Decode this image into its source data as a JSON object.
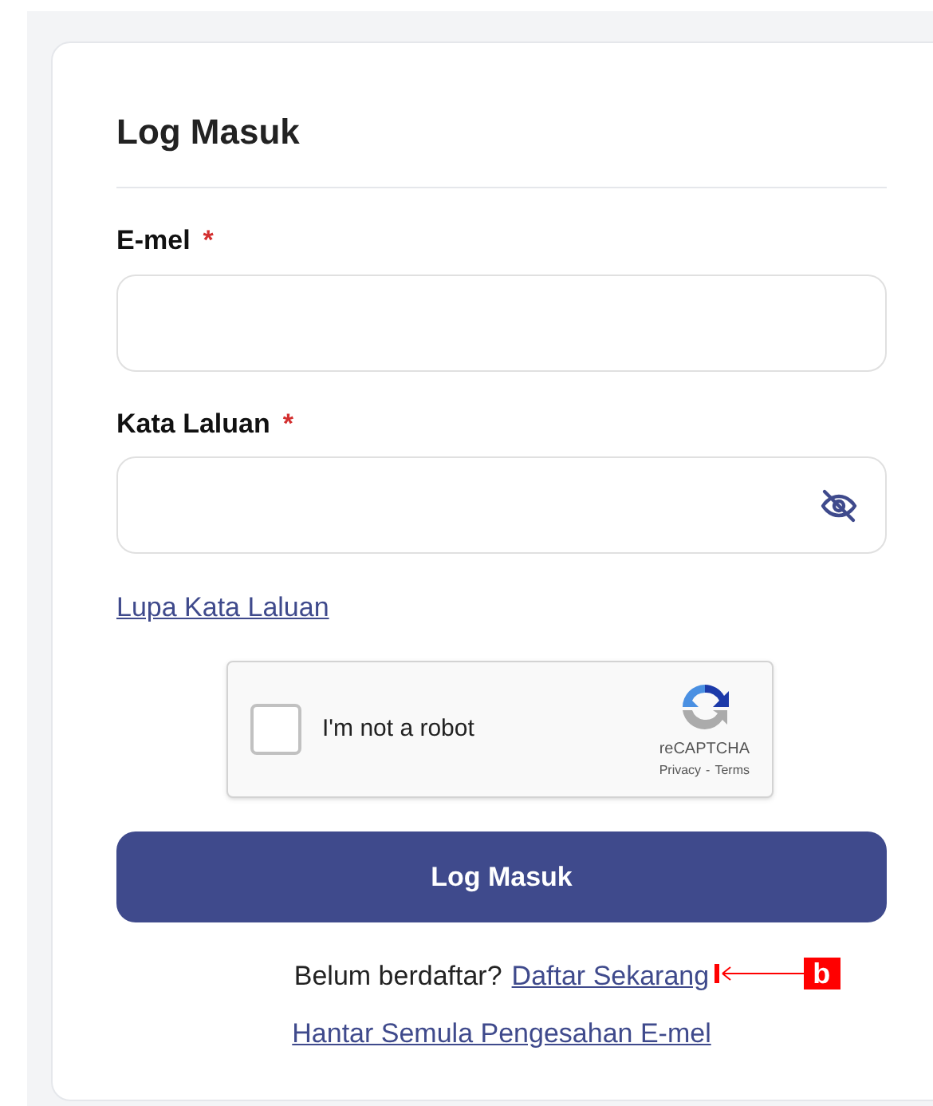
{
  "title": "Log Masuk",
  "fields": [
    {
      "label": "E-mel",
      "required_mark": "*",
      "kind": "text"
    },
    {
      "label": "Kata Laluan",
      "required_mark": "*",
      "kind": "password"
    }
  ],
  "forgot_link": "Lupa Kata Laluan",
  "captcha": {
    "label": "I'm not a robot",
    "checked": false,
    "brand": "reCAPTCHA",
    "privacy": "Privacy",
    "separator": "-",
    "terms": "Terms"
  },
  "submit_button": "Log Masuk",
  "register_prompt": "Belum berdaftar?",
  "register_link": "Daftar Sekarang",
  "resend_link": "Hantar Semula Pengesahan E-mel",
  "annotations": [
    {
      "label": "b"
    }
  ]
}
